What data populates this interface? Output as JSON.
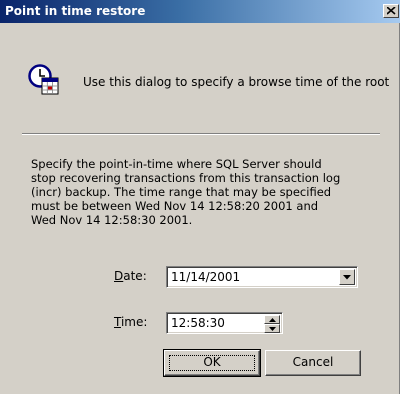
{
  "window": {
    "title": "Point in time restore"
  },
  "info": {
    "icon": "clock-calendar-icon",
    "text": "Use this dialog to specify a browse time of the root"
  },
  "description": {
    "lines": [
      "Specify the point-in-time where SQL Server should",
      "stop recovering transactions from this transaction log",
      "(incr) backup.  The time range that may be specified",
      "must be between Wed Nov 14 12:58:20 2001 and",
      "Wed Nov 14 12:58:30 2001."
    ]
  },
  "date": {
    "label_mnemonic": "D",
    "label_rest": "ate:",
    "value": "11/14/2001"
  },
  "time": {
    "label_mnemonic": "T",
    "label_rest": "ime:",
    "value": "12:58:30"
  },
  "buttons": {
    "ok": "OK",
    "cancel": "Cancel"
  },
  "colors": {
    "title_start": "#0a246a",
    "title_end": "#a6caf0",
    "face": "#d4d0c8"
  }
}
